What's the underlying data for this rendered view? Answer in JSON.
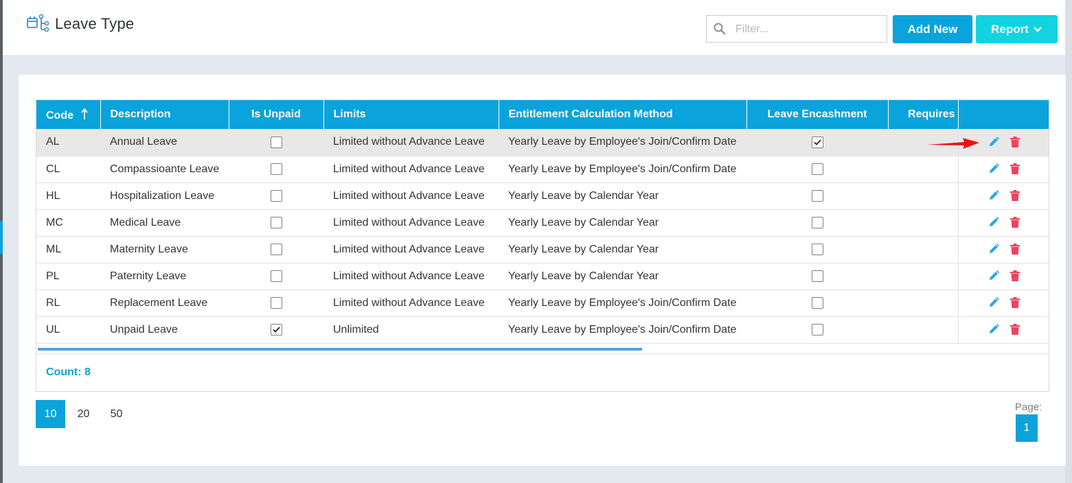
{
  "header": {
    "title": "Leave Type",
    "filter_placeholder": "Filter...",
    "add_new_label": "Add New",
    "report_label": "Report"
  },
  "colors": {
    "primary": "#0aa3dc",
    "report": "#11d3e2",
    "edit": "#29a9e0",
    "delete": "#f0425f",
    "arrow": "#ee1111"
  },
  "table": {
    "columns": {
      "code": "Code",
      "description": "Description",
      "is_unpaid": "Is Unpaid",
      "limits": "Limits",
      "entitlement": "Entitlement Calculation Method",
      "encashment": "Leave Encashment",
      "requires": "Requires"
    },
    "sort": {
      "column": "code",
      "direction": "ascending",
      "icon": "sort-arrow-up-icon"
    },
    "rows": [
      {
        "code": "AL",
        "description": "Annual Leave",
        "is_unpaid": false,
        "limits": "Limited without Advance Leave",
        "entitlement": "Yearly Leave by Employee's Join/Confirm Date",
        "encashment": true
      },
      {
        "code": "CL",
        "description": "Compassioante Leave",
        "is_unpaid": false,
        "limits": "Limited without Advance Leave",
        "entitlement": "Yearly Leave by Employee's Join/Confirm Date",
        "encashment": false
      },
      {
        "code": "HL",
        "description": "Hospitalization Leave",
        "is_unpaid": false,
        "limits": "Limited without Advance Leave",
        "entitlement": "Yearly Leave by Calendar Year",
        "encashment": false
      },
      {
        "code": "MC",
        "description": "Medical Leave",
        "is_unpaid": false,
        "limits": "Limited without Advance Leave",
        "entitlement": "Yearly Leave by Calendar Year",
        "encashment": false
      },
      {
        "code": "ML",
        "description": "Maternity Leave",
        "is_unpaid": false,
        "limits": "Limited without Advance Leave",
        "entitlement": "Yearly Leave by Calendar Year",
        "encashment": false
      },
      {
        "code": "PL",
        "description": "Paternity Leave",
        "is_unpaid": false,
        "limits": "Limited without Advance Leave",
        "entitlement": "Yearly Leave by Calendar Year",
        "encashment": false
      },
      {
        "code": "RL",
        "description": "Replacement Leave",
        "is_unpaid": false,
        "limits": "Limited without Advance Leave",
        "entitlement": "Yearly Leave by Employee's Join/Confirm Date",
        "encashment": false
      },
      {
        "code": "UL",
        "description": "Unpaid Leave",
        "is_unpaid": true,
        "limits": "Unlimited",
        "entitlement": "Yearly Leave by Employee's Join/Confirm Date",
        "encashment": false
      }
    ],
    "count_label": "Count: 8"
  },
  "pagination": {
    "sizes": [
      "10",
      "20",
      "50"
    ],
    "selected_size": "10",
    "page_label": "Page:",
    "current_page": "1"
  }
}
